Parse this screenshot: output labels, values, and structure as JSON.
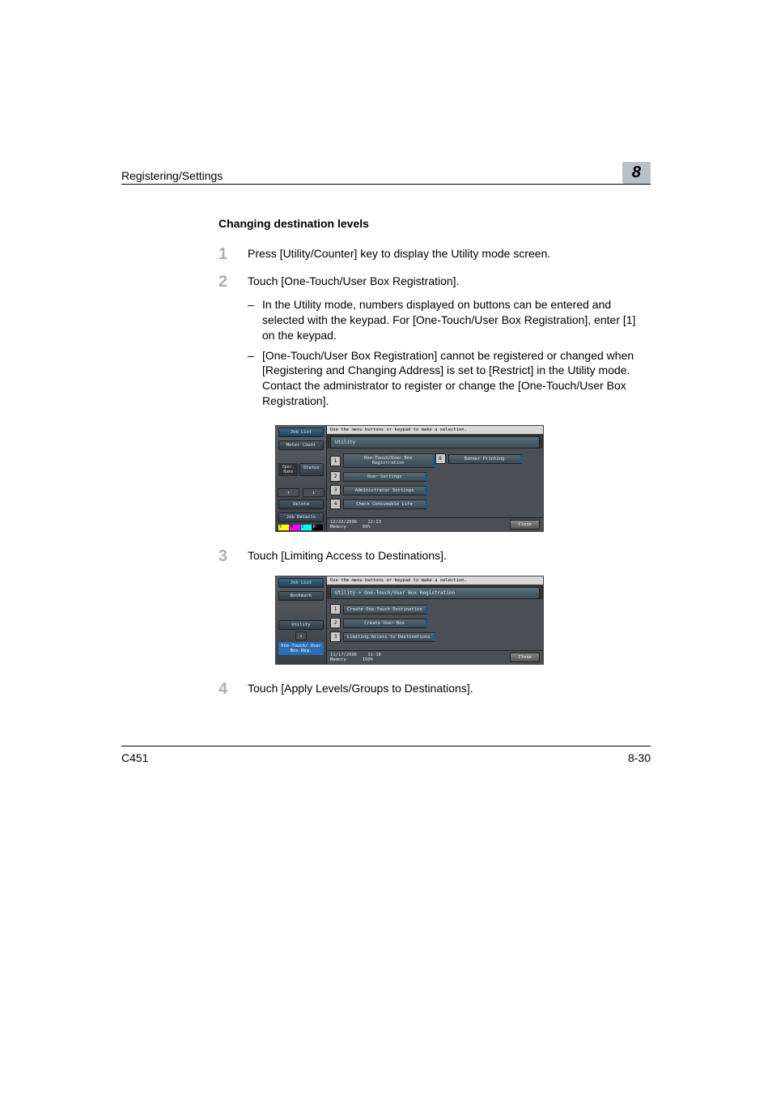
{
  "header": {
    "title": "Registering/Settings",
    "chapter": "8"
  },
  "section": {
    "title": "Changing destination levels"
  },
  "steps": [
    {
      "num": "1",
      "text": "Press [Utility/Counter] key to display the Utility mode screen."
    },
    {
      "num": "2",
      "text": "Touch [One-Touch/User Box Registration].",
      "subs": [
        "In the Utility mode, numbers displayed on buttons can be entered and selected with the keypad. For [One-Touch/User Box Registration], enter [1] on the keypad.",
        "[One-Touch/User Box Registration] cannot be registered or changed when [Registering and Changing Address] is set to [Restrict] in the Utility mode. Contact the administrator to register or change the [One-Touch/User Box Registration]."
      ]
    },
    {
      "num": "3",
      "text": "Touch [Limiting Access to Destinations]."
    },
    {
      "num": "4",
      "text": "Touch [Apply Levels/Groups to Destinations]."
    }
  ],
  "screen1": {
    "instr": "Use the menu buttons or keypad to make a selection.",
    "title": "Utility",
    "left": {
      "job_list": "Job List",
      "meter_count": "Meter Count",
      "oper_name": "Oper. Name",
      "status": "Status",
      "up": "↑",
      "down": "↓",
      "delete": "Delete",
      "job_details": "Job Details",
      "toner": [
        "Y",
        "M",
        "C",
        "K"
      ]
    },
    "items": [
      {
        "n": "1",
        "label": "One-Touch/User Box Registration"
      },
      {
        "n": "2",
        "label": "User Settings"
      },
      {
        "n": "3",
        "label": "Administrator Settings"
      },
      {
        "n": "4",
        "label": "Check Consumable Life"
      }
    ],
    "items_right": [
      {
        "n": "6",
        "label": "Banner Printing"
      }
    ],
    "footer": {
      "date": "12/22/2006",
      "time": "12:13",
      "mem_label": "Memory",
      "mem": "99%",
      "close": "Close"
    }
  },
  "screen2": {
    "instr": "Use the menu buttons or keypad to make a selection.",
    "title": "Utility > One-Touch/User Box Registration",
    "left": {
      "job_list": "Job List",
      "bookmark": "Bookmark",
      "utility": "Utility",
      "down": "↓",
      "onetouch": "One-Touch/ User Box Reg."
    },
    "items": [
      {
        "n": "1",
        "label": "Create One-Touch Destination"
      },
      {
        "n": "2",
        "label": "Create User Box"
      },
      {
        "n": "3",
        "label": "Limiting Access to Destinations"
      }
    ],
    "footer": {
      "date": "11/17/2006",
      "time": "11:18",
      "mem_label": "Memory",
      "mem": "100%",
      "close": "Close"
    }
  },
  "footer": {
    "model": "C451",
    "page": "8-30"
  }
}
